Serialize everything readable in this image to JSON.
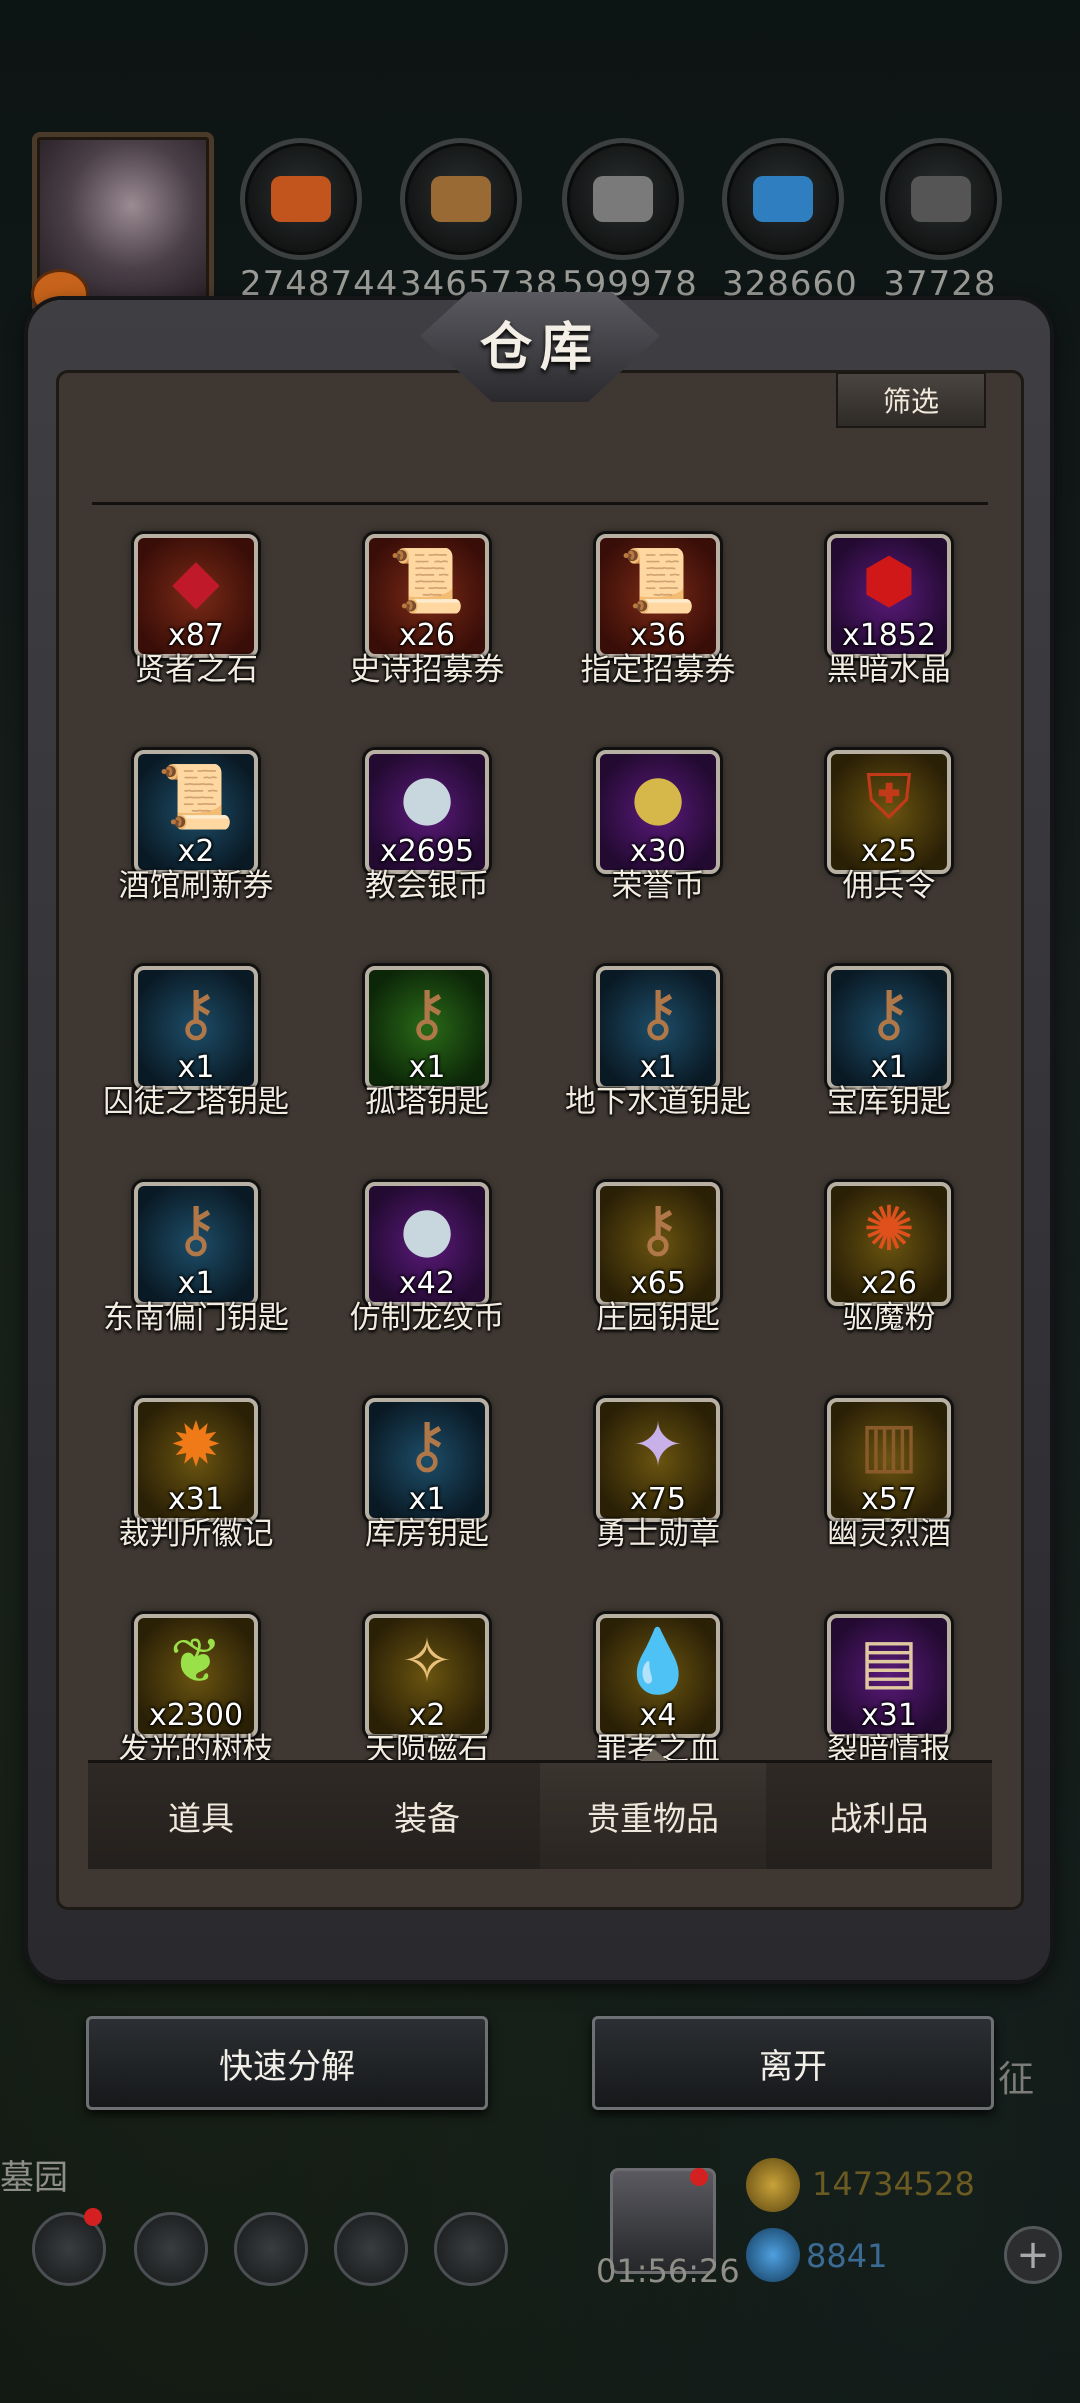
{
  "resources": [
    {
      "icon": "orange-ore-icon",
      "value": "2748744",
      "color": "#c2541e"
    },
    {
      "icon": "wood-planks-icon",
      "value": "3465738",
      "color": "#9a6a34"
    },
    {
      "icon": "iron-ingot-icon",
      "value": "599978",
      "color": "#7a7a7a"
    },
    {
      "icon": "blue-crystal-icon",
      "value": "328660",
      "color": "#2f7fc0"
    },
    {
      "icon": "dark-ingot-icon",
      "value": "37728",
      "color": "#555555"
    }
  ],
  "panel": {
    "title": "仓库",
    "filter_label": "筛选"
  },
  "items": [
    {
      "name": "贤者之石",
      "count": "x87",
      "rarity": "red",
      "glyph": "◆",
      "color": "#c01a2a"
    },
    {
      "name": "史诗招募券",
      "count": "x26",
      "rarity": "red",
      "glyph": "📜",
      "color": "#d8b55a"
    },
    {
      "name": "指定招募券",
      "count": "x36",
      "rarity": "red",
      "glyph": "📜",
      "color": "#d8b55a"
    },
    {
      "name": "黑暗水晶",
      "count": "x1852",
      "rarity": "purple",
      "glyph": "⬢",
      "color": "#d01818"
    },
    {
      "name": "酒馆刷新券",
      "count": "x2",
      "rarity": "blue",
      "glyph": "📜",
      "color": "#d8b55a"
    },
    {
      "name": "教会银币",
      "count": "x2695",
      "rarity": "purple",
      "glyph": "●",
      "color": "#c8d6de"
    },
    {
      "name": "荣誉币",
      "count": "x30",
      "rarity": "purple",
      "glyph": "●",
      "color": "#d6b84a"
    },
    {
      "name": "佣兵令",
      "count": "x25",
      "rarity": "gold",
      "glyph": "⛨",
      "color": "#c23a18"
    },
    {
      "name": "囚徒之塔钥匙",
      "count": "x1",
      "rarity": "blue",
      "glyph": "⚷",
      "color": "#b07848"
    },
    {
      "name": "孤塔钥匙",
      "count": "x1",
      "rarity": "green",
      "glyph": "⚷",
      "color": "#b07848"
    },
    {
      "name": "地下水道钥匙",
      "count": "x1",
      "rarity": "blue",
      "glyph": "⚷",
      "color": "#b07848"
    },
    {
      "name": "宝库钥匙",
      "count": "x1",
      "rarity": "blue",
      "glyph": "⚷",
      "color": "#b07848"
    },
    {
      "name": "东南偏门钥匙",
      "count": "x1",
      "rarity": "blue",
      "glyph": "⚷",
      "color": "#b07848"
    },
    {
      "name": "仿制龙纹币",
      "count": "x42",
      "rarity": "purple",
      "glyph": "●",
      "color": "#c8d6de"
    },
    {
      "name": "庄园钥匙",
      "count": "x65",
      "rarity": "gold",
      "glyph": "⚷",
      "color": "#b07848"
    },
    {
      "name": "驱魔粉",
      "count": "x26",
      "rarity": "gold",
      "glyph": "✺",
      "color": "#e0501c"
    },
    {
      "name": "裁判所徽记",
      "count": "x31",
      "rarity": "gold",
      "glyph": "✹",
      "color": "#f07a18"
    },
    {
      "name": "库房钥匙",
      "count": "x1",
      "rarity": "blue",
      "glyph": "⚷",
      "color": "#b07848"
    },
    {
      "name": "勇士勋章",
      "count": "x75",
      "rarity": "gold",
      "glyph": "✦",
      "color": "#c8b0e8"
    },
    {
      "name": "幽灵烈酒",
      "count": "x57",
      "rarity": "gold",
      "glyph": "▥",
      "color": "#8a5a2a"
    },
    {
      "name": "发光的树枝",
      "count": "x2300",
      "rarity": "gold",
      "glyph": "❦",
      "color": "#9ae048"
    },
    {
      "name": "天陨磁石",
      "count": "x2",
      "rarity": "gold",
      "glyph": "✧",
      "color": "#e8c07a"
    },
    {
      "name": "罪者之血",
      "count": "x4",
      "rarity": "gold",
      "glyph": "💧",
      "color": "#d01818"
    },
    {
      "name": "裂暗情报",
      "count": "x31",
      "rarity": "purple",
      "glyph": "▤",
      "color": "#e0c8a0"
    }
  ],
  "tabs": [
    {
      "label": "道具",
      "active": false
    },
    {
      "label": "装备",
      "active": false
    },
    {
      "label": "贵重物品",
      "active": true
    },
    {
      "label": "战利品",
      "active": false
    }
  ],
  "actions": {
    "decompose_label": "快速分解",
    "leave_label": "离开"
  },
  "hud": {
    "left_label": "墓园",
    "right_label": "征",
    "gift_timer": "01:56:26",
    "gold": "14734528",
    "gems": "8841"
  }
}
